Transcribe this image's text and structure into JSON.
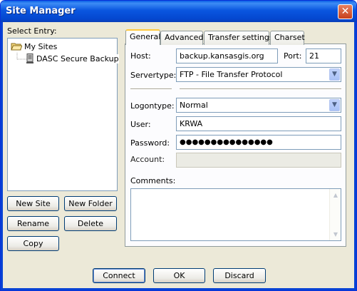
{
  "window": {
    "title": "Site Manager",
    "close_glyph": "✕"
  },
  "left": {
    "select_entry_label": "Select Entry:",
    "tree": [
      {
        "label": "My Sites",
        "icon": "folder-open-icon"
      },
      {
        "label": "DASC Secure Backup",
        "icon": "server-icon"
      }
    ],
    "buttons": {
      "new_site": "New Site",
      "new_folder": "New Folder",
      "rename": "Rename",
      "delete": "Delete",
      "copy": "Copy"
    }
  },
  "tabs": [
    "General",
    "Advanced",
    "Transfer settings",
    "Charset"
  ],
  "general": {
    "host_label": "Host:",
    "host_value": "backup.kansasgis.org",
    "port_label": "Port:",
    "port_value": "21",
    "servertype_label": "Servertype:",
    "servertype_value": "FTP - File Transfer Protocol",
    "logontype_label": "Logontype:",
    "logontype_value": "Normal",
    "user_label": "User:",
    "user_value": "KRWA",
    "password_label": "Password:",
    "password_value": "●●●●●●●●●●●●●●●",
    "account_label": "Account:",
    "account_value": "",
    "comments_label": "Comments:",
    "comments_value": ""
  },
  "footer": {
    "connect": "Connect",
    "ok": "OK",
    "discard": "Discard"
  }
}
